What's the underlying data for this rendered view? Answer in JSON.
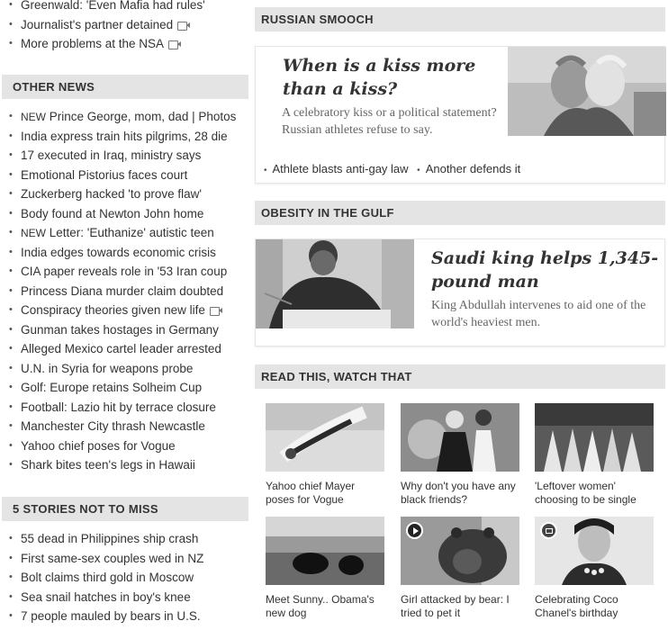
{
  "top_links": [
    {
      "text": "Greenwald: 'Even Mafia had rules'",
      "video": false
    },
    {
      "text": "Journalist's partner detained",
      "video": true
    },
    {
      "text": "More problems at the NSA",
      "video": true
    }
  ],
  "other_news": {
    "heading": "OTHER NEWS",
    "items": [
      {
        "prefix": "NEW",
        "text": "Prince George, mom, dad | Photos",
        "video": false
      },
      {
        "prefix": "",
        "text": "India express train hits pilgrims, 28 die",
        "video": false
      },
      {
        "prefix": "",
        "text": "17 executed in Iraq, ministry says",
        "video": false
      },
      {
        "prefix": "",
        "text": "Emotional Pistorius faces court",
        "video": false
      },
      {
        "prefix": "",
        "text": "Zuckerberg hacked 'to prove flaw'",
        "video": false
      },
      {
        "prefix": "",
        "text": "Body found at Newton John home",
        "video": false
      },
      {
        "prefix": "NEW",
        "text": "Letter: 'Euthanize' autistic teen",
        "video": false
      },
      {
        "prefix": "",
        "text": "India edges towards economic crisis",
        "video": false
      },
      {
        "prefix": "",
        "text": "CIA paper reveals role in '53 Iran coup",
        "video": false
      },
      {
        "prefix": "",
        "text": "Princess Diana murder claim doubted",
        "video": false
      },
      {
        "prefix": "",
        "text": "Conspiracy theories given new life",
        "video": true
      },
      {
        "prefix": "",
        "text": "Gunman takes hostages in Germany",
        "video": false
      },
      {
        "prefix": "",
        "text": "Alleged Mexico cartel leader arrested",
        "video": false
      },
      {
        "prefix": "",
        "text": "U.N. in Syria for weapons probe",
        "video": false
      },
      {
        "prefix": "",
        "text": "Golf: Europe retains Solheim Cup",
        "video": false
      },
      {
        "prefix": "",
        "text": "Football: Lazio hit by terrace closure",
        "video": false
      },
      {
        "prefix": "",
        "text": "Manchester City thrash Newcastle",
        "video": false
      },
      {
        "prefix": "",
        "text": "Yahoo chief poses for Vogue",
        "video": false
      },
      {
        "prefix": "",
        "text": "Shark bites teen's legs in Hawaii",
        "video": false
      }
    ]
  },
  "not_to_miss": {
    "heading": "5 STORIES NOT TO MISS",
    "items": [
      {
        "text": "55 dead in Philippines ship crash"
      },
      {
        "text": "First same-sex couples wed in NZ"
      },
      {
        "text": "Bolt claims third gold in Moscow"
      },
      {
        "text": "Sea snail hatches in boy's knee"
      },
      {
        "text": "7 people mauled by bears in U.S."
      }
    ]
  },
  "russian_smooch": {
    "heading": "RUSSIAN SMOOCH",
    "headline": "When is a kiss more than a kiss?",
    "dek": "A celebratory kiss or a political statement? Russian athletes refuse to say.",
    "links": [
      "Athlete blasts anti-gay law",
      "Another defends it"
    ]
  },
  "obesity": {
    "heading": "OBESITY IN THE GULF",
    "headline": "Saudi king helps 1,345-pound man",
    "dek": "King Abdullah intervenes to aid one of the world's heaviest men."
  },
  "read_watch": {
    "heading": "READ THIS, WATCH THAT",
    "tiles": [
      {
        "caption": "Yahoo chief Mayer poses for Vogue",
        "badge": ""
      },
      {
        "caption": "Why don't you have any black friends?",
        "badge": ""
      },
      {
        "caption": "'Leftover women' choosing to be single",
        "badge": ""
      },
      {
        "caption": "Meet Sunny.. Obama's new dog",
        "badge": ""
      },
      {
        "caption": "Girl attacked by bear: I tried to pet it",
        "badge": "play-icon"
      },
      {
        "caption": "Celebrating Coco Chanel's birthday",
        "badge": "gallery-icon"
      }
    ]
  }
}
